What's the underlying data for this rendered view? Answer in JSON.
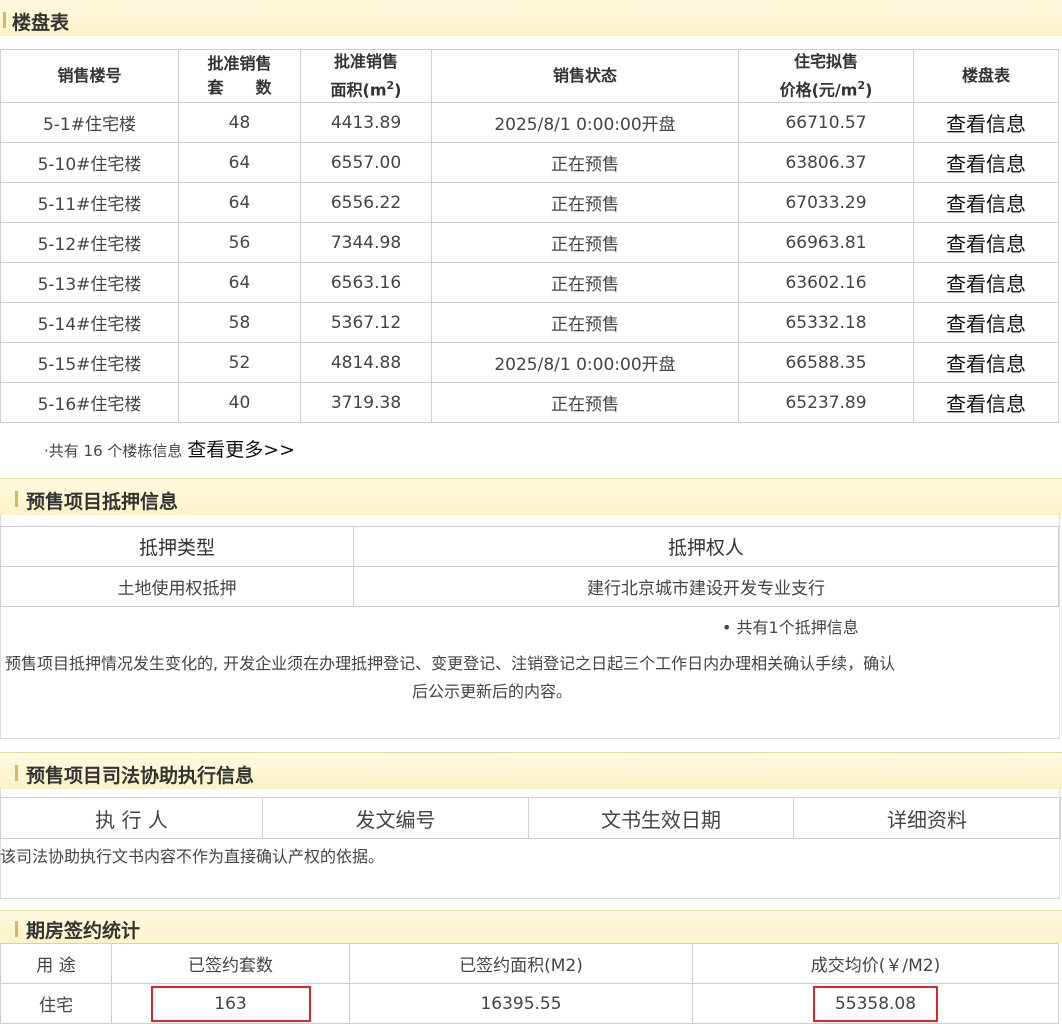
{
  "buildings": {
    "title": "楼盘表",
    "headers": [
      "销售楼号",
      "批准销售\n套　　数",
      "批准销售\n面积(m²)",
      "销售状态",
      "住宅拟售\n价格(元/m²)",
      "楼盘表"
    ],
    "rows": [
      {
        "name": "5-1#住宅楼",
        "units": "48",
        "area": "4413.89",
        "status": "2025/8/1 0:00:00开盘",
        "price": "66710.57",
        "link": "查看信息"
      },
      {
        "name": "5-10#住宅楼",
        "units": "64",
        "area": "6557.00",
        "status": "正在预售",
        "price": "63806.37",
        "link": "查看信息"
      },
      {
        "name": "5-11#住宅楼",
        "units": "64",
        "area": "6556.22",
        "status": "正在预售",
        "price": "67033.29",
        "link": "查看信息"
      },
      {
        "name": "5-12#住宅楼",
        "units": "56",
        "area": "7344.98",
        "status": "正在预售",
        "price": "66963.81",
        "link": "查看信息"
      },
      {
        "name": "5-13#住宅楼",
        "units": "64",
        "area": "6563.16",
        "status": "正在预售",
        "price": "63602.16",
        "link": "查看信息"
      },
      {
        "name": "5-14#住宅楼",
        "units": "58",
        "area": "5367.12",
        "status": "正在预售",
        "price": "65332.18",
        "link": "查看信息"
      },
      {
        "name": "5-15#住宅楼",
        "units": "52",
        "area": "4814.88",
        "status": "2025/8/1 0:00:00开盘",
        "price": "66588.35",
        "link": "查看信息"
      },
      {
        "name": "5-16#住宅楼",
        "units": "40",
        "area": "3719.38",
        "status": "正在预售",
        "price": "65237.89",
        "link": "查看信息"
      }
    ],
    "summary": "·共有 16 个楼栋信息",
    "more_link": "查看更多>>"
  },
  "mortgage": {
    "title": "预售项目抵押信息",
    "headers": [
      "抵押类型",
      "抵押权人"
    ],
    "row": {
      "type": "土地使用权抵押",
      "holder": "建行北京城市建设开发专业支行"
    },
    "count": "• 共有1个抵押信息",
    "note_line1": "预售项目抵押情况发生变化的, 开发企业须在办理抵押登记、变更登记、注销登记之日起三个工作日内办理相关确认手续，确认",
    "note_line2": "后公示更新后的内容。"
  },
  "judicial": {
    "title": "预售项目司法协助执行信息",
    "headers": [
      "执 行 人",
      "发文编号",
      "文书生效日期",
      "详细资料"
    ],
    "note": "该司法协助执行文书内容不作为直接确认产权的依据。"
  },
  "signing": {
    "title": "期房签约统计",
    "headers": [
      "用 途",
      "已签约套数",
      "已签约面积(M2)",
      "成交均价(￥/M2)"
    ],
    "row": {
      "use": "住宅",
      "count": "163",
      "area": "16395.55",
      "avg_price": "55358.08"
    }
  },
  "colors": {
    "section_bar": "#d9b65f",
    "header_bg": "#fdf3c8",
    "highlight": "#d9272b"
  }
}
